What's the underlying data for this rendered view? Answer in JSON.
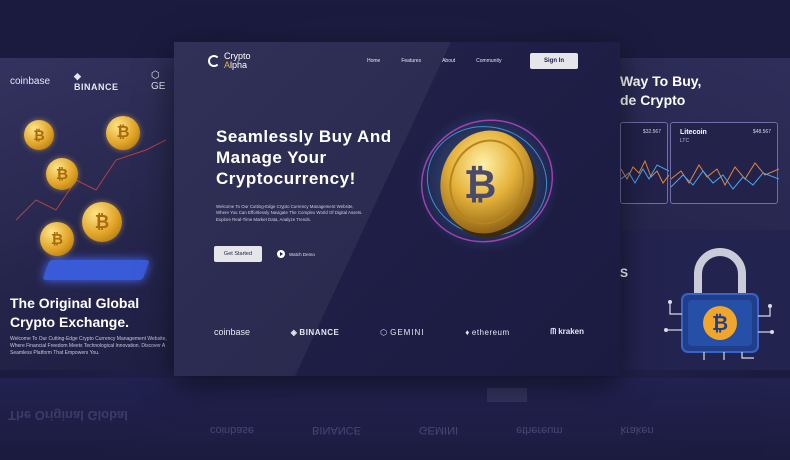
{
  "left_panel": {
    "logos": [
      "coinbase",
      "BINANCE",
      "GE"
    ],
    "title_line1": "The Original Global",
    "title_line2": "Crypto Exchange.",
    "description": "Welcome To Our Cutting-Edge Crypto Currency Management Website, Where Financial Freedom Meets Technological Innovation. Discover A Seamless Platform That Empowers You."
  },
  "right_panel": {
    "title_line1": "Way To Buy,",
    "title_line2": "de Crypto",
    "card_left_price": "$32.567",
    "card_name": "Litecoin",
    "card_symbol": "LTC",
    "card_price": "$48.567",
    "lower_letter": "S"
  },
  "main": {
    "logo_word1": "Crypto",
    "logo_word2_accent": "A",
    "logo_word2_rest": "lpha",
    "nav": [
      "Home",
      "Features",
      "About",
      "Community"
    ],
    "signin_label": "Sign In",
    "hero_line1": "Seamlessly Buy And",
    "hero_line2": "Manage Your",
    "hero_line3": "Cryptocurrency!",
    "hero_desc_line1": "Welcome To Our Cutting-Edge Crypto Currency Management Website,",
    "hero_desc_line2": "Where You Can Effortlessly Navigate The Complex World Of Digital Assets.",
    "hero_desc_line3": "Explore Real-Time Market Data, Analyze Trends.",
    "get_started_label": "Get Started",
    "watch_demo_label": "Watch Demo",
    "partners": [
      "coinbase",
      "BINANCE",
      "GEMINI",
      "ethereum",
      "kraken"
    ]
  },
  "reflection": {
    "left_text": "The Original Global",
    "logos": [
      "coinbase",
      "BINANCE",
      "GEMINI",
      "ethereum",
      "kraken"
    ]
  },
  "colors": {
    "background": "#1d1d45",
    "accent_gold": "#f3b41f",
    "button": "#e6e6ea"
  }
}
